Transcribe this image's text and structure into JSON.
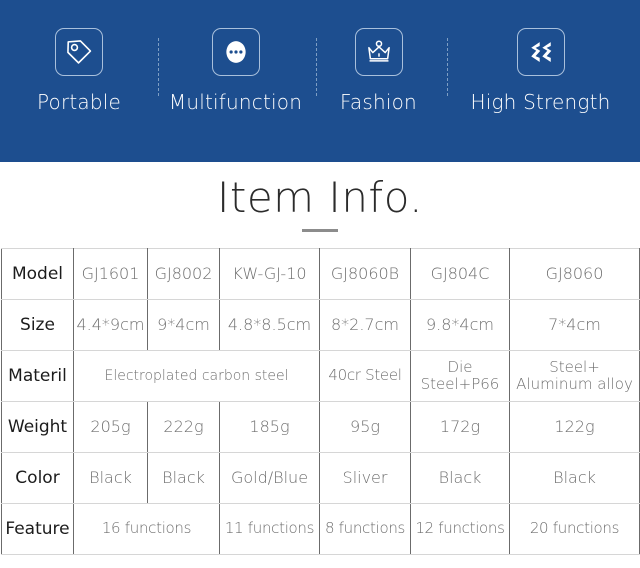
{
  "banner": {
    "background_color": "#1d4e8f",
    "features": [
      {
        "label": "Portable",
        "icon": "price-tag-icon"
      },
      {
        "label": "Multifunction",
        "icon": "three-dots-circle-icon"
      },
      {
        "label": "Fashion",
        "icon": "crown-icon"
      },
      {
        "label": "High Strength",
        "icon": "double-chevron-icon"
      }
    ]
  },
  "title": {
    "text": "Item Info.",
    "rule_color": "#8c8c8c"
  },
  "spec_table": {
    "rows": [
      {
        "label": "Model",
        "cells": [
          {
            "text": "GJ1601",
            "span": 1
          },
          {
            "text": "GJ8002",
            "span": 1
          },
          {
            "text": "KW-GJ-10",
            "span": 1
          },
          {
            "text": "GJ8060B",
            "span": 1
          },
          {
            "text": "GJ804C",
            "span": 1
          },
          {
            "text": "GJ8060",
            "span": 1
          }
        ]
      },
      {
        "label": "Size",
        "cells": [
          {
            "text": "4.4*9cm",
            "span": 1
          },
          {
            "text": "9*4cm",
            "span": 1
          },
          {
            "text": "4.8*8.5cm",
            "span": 1
          },
          {
            "text": "8*2.7cm",
            "span": 1
          },
          {
            "text": "9.8*4cm",
            "span": 1
          },
          {
            "text": "7*4cm",
            "span": 1
          }
        ]
      },
      {
        "label": "Materil",
        "cells": [
          {
            "text": "Electroplated carbon steel",
            "span": 3
          },
          {
            "text": "40cr Steel",
            "span": 1
          },
          {
            "text": "Die Steel+P66",
            "span": 1,
            "lines": [
              "Die",
              "Steel+P66"
            ]
          },
          {
            "text": "Steel+ Aluminum alloy",
            "span": 1,
            "lines": [
              "Steel+",
              "Aluminum alloy"
            ]
          }
        ]
      },
      {
        "label": "Weight",
        "cells": [
          {
            "text": "205g",
            "span": 1
          },
          {
            "text": "222g",
            "span": 1
          },
          {
            "text": "185g",
            "span": 1
          },
          {
            "text": "95g",
            "span": 1
          },
          {
            "text": "172g",
            "span": 1
          },
          {
            "text": "122g",
            "span": 1
          }
        ]
      },
      {
        "label": "Color",
        "cells": [
          {
            "text": "Black",
            "span": 1
          },
          {
            "text": "Black",
            "span": 1
          },
          {
            "text": "Gold/Blue",
            "span": 1
          },
          {
            "text": "Sliver",
            "span": 1
          },
          {
            "text": "Black",
            "span": 1
          },
          {
            "text": "Black",
            "span": 1
          }
        ]
      },
      {
        "label": "Feature",
        "cells": [
          {
            "text": "16 functions",
            "span": 2
          },
          {
            "text": "11 functions",
            "span": 1
          },
          {
            "text": "8 functions",
            "span": 1
          },
          {
            "text": "12 functions",
            "span": 1
          },
          {
            "text": "20 functions",
            "span": 1
          }
        ]
      }
    ]
  }
}
